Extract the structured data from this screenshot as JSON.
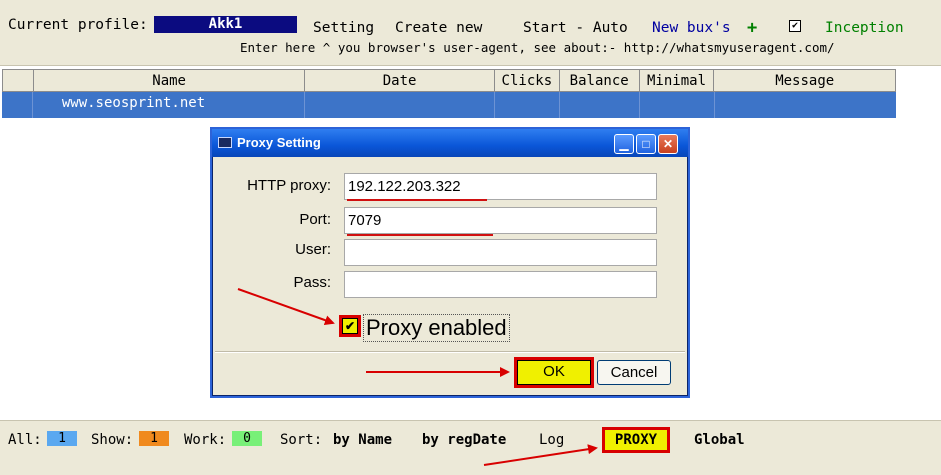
{
  "toolbar": {
    "profile_label": "Current profile:",
    "profile_value": "Akk1",
    "setting": "Setting",
    "create_new": "Create new",
    "start_auto": "Start - Auto",
    "new_bux": "New bux's",
    "plus": "+",
    "inception_checked": true,
    "inception": "Inception",
    "hint": "Enter here ^ you browser's user-agent, see about:- http://whatsmyuseragent.com/"
  },
  "table": {
    "columns": [
      "",
      "Name",
      "Date",
      "Clicks",
      "Balance",
      "Minimal",
      "Message"
    ],
    "rows": [
      [
        "",
        "www.seosprint.net",
        "",
        "",
        "",
        "",
        ""
      ]
    ]
  },
  "dialog": {
    "title": "Proxy Setting",
    "http_proxy_label": "HTTP proxy:",
    "http_proxy_value": "192.122.203.322",
    "port_label": "Port:",
    "port_value": "7079",
    "user_label": "User:",
    "user_value": "",
    "pass_label": "Pass:",
    "pass_value": "",
    "proxy_enabled_label": "Proxy enabled",
    "proxy_enabled": true,
    "ok": "OK",
    "cancel": "Cancel"
  },
  "status": {
    "all_label": "All:",
    "all_value": "1",
    "show_label": "Show:",
    "show_value": "1",
    "work_label": "Work:",
    "work_value": "0",
    "sort_label": "Sort:",
    "by_name": "by Name",
    "by_regdate": "by regDate",
    "log": "Log",
    "proxy": "PROXY",
    "global": "Global"
  },
  "colors": {
    "profile_bg": "#0b0b80",
    "selected_row": "#3d74c8",
    "all_badge": "#5aa8f0",
    "show_badge": "#f08a1e",
    "work_badge": "#78f078",
    "highlight": "#f0f000",
    "highlight_border": "#d80000",
    "arrow": "#d80000"
  }
}
